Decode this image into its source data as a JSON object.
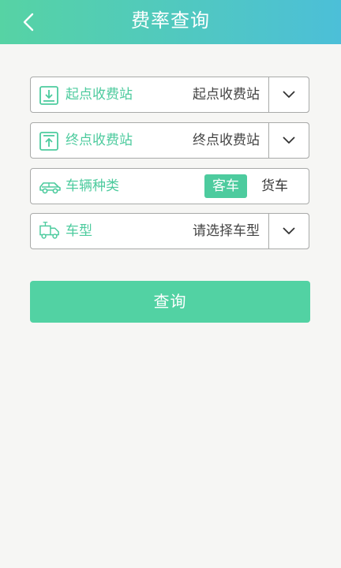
{
  "header": {
    "title": "费率查询",
    "back_icon": "chevron-left-icon"
  },
  "form": {
    "start_station": {
      "label": "起点收费站",
      "value": "起点收费站",
      "icon": "download-box-icon"
    },
    "end_station": {
      "label": "终点收费站",
      "value": "终点收费站",
      "icon": "upload-box-icon"
    },
    "vehicle_category": {
      "label": "车辆种类",
      "icon": "car-icon",
      "options": [
        "客车",
        "货车"
      ],
      "selected": "客车"
    },
    "vehicle_model": {
      "label": "车型",
      "placeholder": "请选择车型",
      "icon": "truck-icon"
    }
  },
  "actions": {
    "query_label": "查询"
  },
  "colors": {
    "accent": "#4dcb9e",
    "header_start": "#56d3a4",
    "header_end": "#4cbfd8",
    "background": "#f6f6f4"
  }
}
